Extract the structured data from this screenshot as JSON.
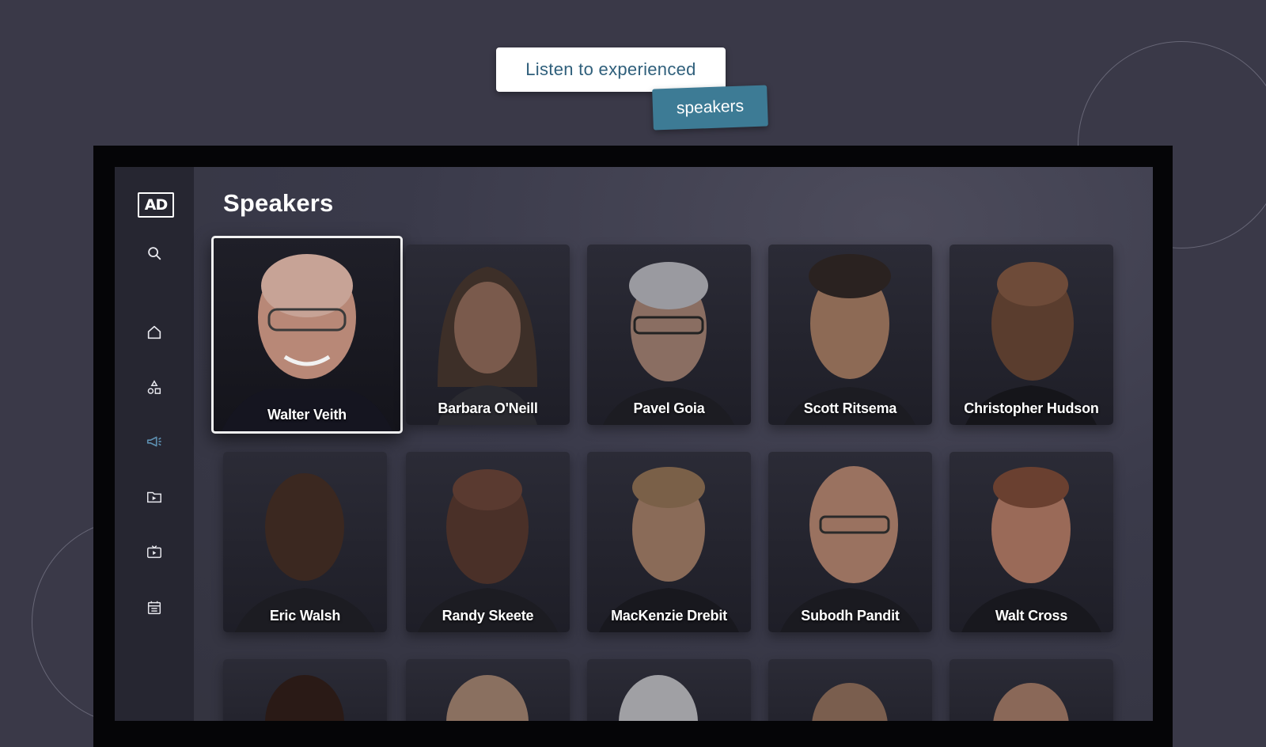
{
  "promo": {
    "line1": "Listen to experienced",
    "line2": "speakers"
  },
  "app": {
    "logo": "AD",
    "page_title": "Speakers"
  },
  "sidebar": {
    "items": [
      {
        "icon": "search-icon",
        "active": false
      },
      {
        "icon": "home-icon",
        "active": false
      },
      {
        "icon": "categories-icon",
        "active": false
      },
      {
        "icon": "megaphone-icon",
        "active": true
      },
      {
        "icon": "library-icon",
        "active": false
      },
      {
        "icon": "tv-icon",
        "active": false
      },
      {
        "icon": "calendar-icon",
        "active": false
      }
    ]
  },
  "speakers": [
    {
      "name": "Walter Veith",
      "focused": true
    },
    {
      "name": "Barbara O'Neill"
    },
    {
      "name": "Pavel Goia"
    },
    {
      "name": "Scott Ritsema"
    },
    {
      "name": "Christopher Hudson"
    },
    {
      "name": "Eric Walsh"
    },
    {
      "name": "Randy Skeete"
    },
    {
      "name": "MacKenzie Drebit"
    },
    {
      "name": "Subodh Pandit"
    },
    {
      "name": "Walt Cross"
    }
  ],
  "colors": {
    "background": "#3a3948",
    "accent": "#3d7b95",
    "active_icon": "#5d8fb0",
    "sidebar": "#262631"
  }
}
